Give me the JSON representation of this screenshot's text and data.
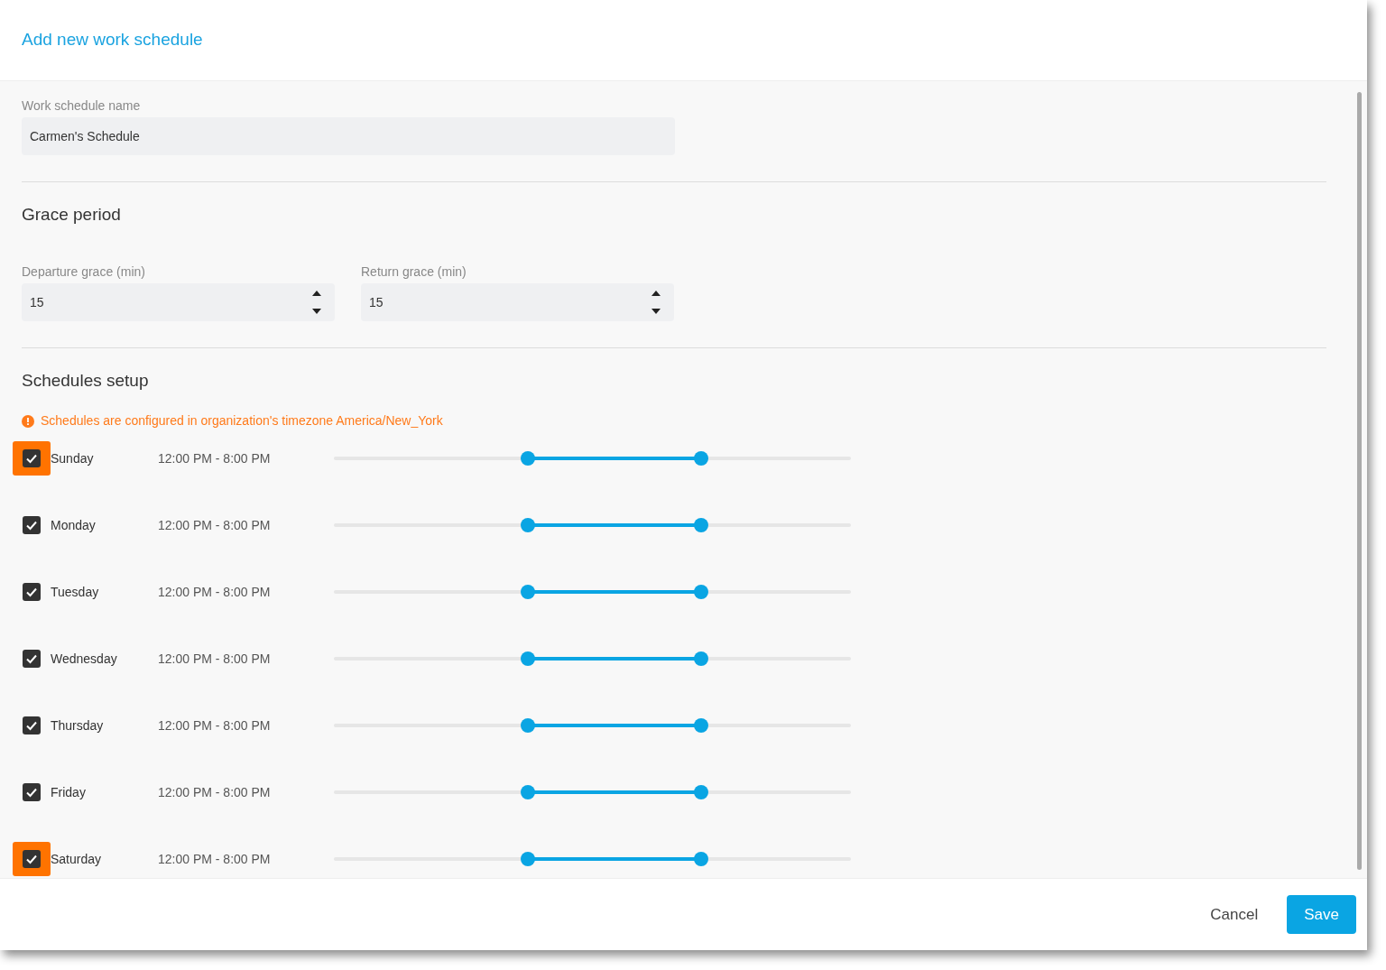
{
  "dialog": {
    "title": "Add new work schedule"
  },
  "name_field": {
    "label": "Work schedule name",
    "value": "Carmen's Schedule"
  },
  "grace_period": {
    "heading": "Grace period",
    "fields": [
      {
        "label": "Departure grace (min)",
        "value": "15"
      },
      {
        "label": "Return grace (min)",
        "value": "15"
      }
    ]
  },
  "schedules": {
    "heading": "Schedules setup",
    "notice": "Schedules are configured in organization's timezone America/New_York",
    "days": [
      {
        "label": "Sunday",
        "checked": true,
        "highlighted": true,
        "time": "12:00 PM - 8:00 PM",
        "from": {
          "level": 0.375
        },
        "to": {
          "level": 0.71
        }
      },
      {
        "label": "Monday",
        "checked": true,
        "highlighted": false,
        "time": "12:00 PM - 8:00 PM",
        "from": {
          "level": 0.375
        },
        "to": {
          "level": 0.71
        }
      },
      {
        "label": "Tuesday",
        "checked": true,
        "highlighted": false,
        "time": "12:00 PM - 8:00 PM",
        "from": {
          "level": 0.375
        },
        "to": {
          "level": 0.71
        }
      },
      {
        "label": "Wednesday",
        "checked": true,
        "highlighted": false,
        "time": "12:00 PM - 8:00 PM",
        "from": {
          "level": 0.375
        },
        "to": {
          "level": 0.71
        }
      },
      {
        "label": "Thursday",
        "checked": true,
        "highlighted": false,
        "time": "12:00 PM - 8:00 PM",
        "from": {
          "level": 0.375
        },
        "to": {
          "level": 0.71
        }
      },
      {
        "label": "Friday",
        "checked": true,
        "highlighted": false,
        "time": "12:00 PM - 8:00 PM",
        "from": {
          "level": 0.375
        },
        "to": {
          "level": 0.71
        }
      },
      {
        "label": "Saturday",
        "checked": true,
        "highlighted": true,
        "time": "12:00 PM - 8:00 PM",
        "from": {
          "level": 0.375
        },
        "to": {
          "level": 0.71
        }
      }
    ]
  },
  "footer": {
    "buttons": [
      {
        "label": "Cancel",
        "kind": "secondary"
      },
      {
        "label": "Save",
        "kind": "primary"
      }
    ]
  }
}
